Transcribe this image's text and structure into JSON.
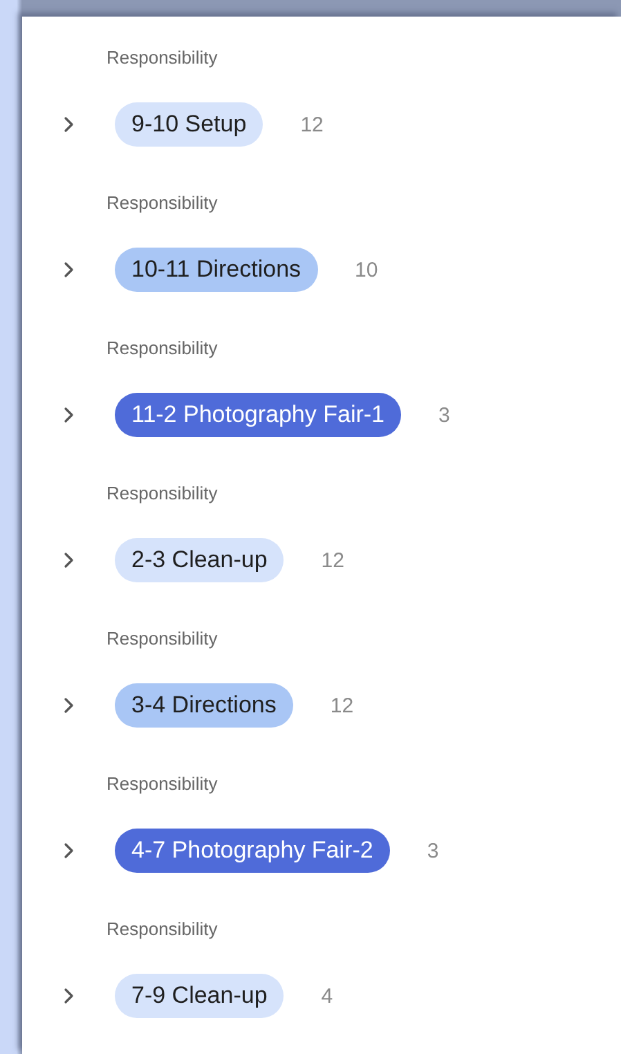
{
  "groups": [
    {
      "label": "Responsibility",
      "tag": "9-10 Setup",
      "color": "#d6e3fb",
      "count": "12"
    },
    {
      "label": "Responsibility",
      "tag": "10-11 Directions",
      "color": "#a9c6f5",
      "count": "10"
    },
    {
      "label": "Responsibility",
      "tag": "11-2 Photography Fair-1",
      "color": "#4f6bd9",
      "count": "3"
    },
    {
      "label": "Responsibility",
      "tag": "2-3 Clean-up",
      "color": "#d6e3fb",
      "count": "12"
    },
    {
      "label": "Responsibility",
      "tag": "3-4 Directions",
      "color": "#a9c6f5",
      "count": "12"
    },
    {
      "label": "Responsibility",
      "tag": "4-7 Photography Fair-2",
      "color": "#4f6bd9",
      "count": "3"
    },
    {
      "label": "Responsibility",
      "tag": "7-9 Clean-up",
      "color": "#d6e3fb",
      "count": "4"
    }
  ]
}
